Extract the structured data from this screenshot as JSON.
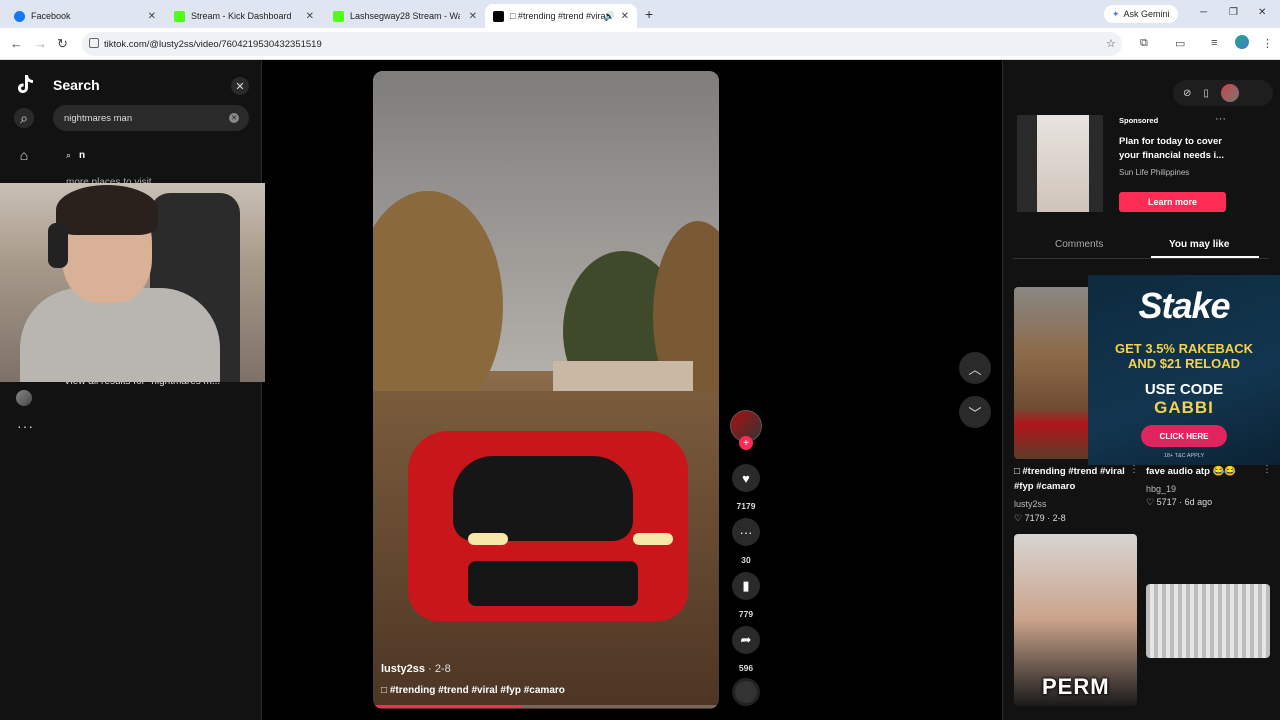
{
  "browser": {
    "tabs": [
      {
        "title": "Facebook",
        "favicon_color": "#1877f2"
      },
      {
        "title": "Stream - Kick Dashboard",
        "favicon_color": "#53fc18"
      },
      {
        "title": "Lashsegway28 Stream - Watch",
        "favicon_color": "#53fc18"
      },
      {
        "title": "□ #trending #trend #viral #",
        "favicon_color": "#000000"
      }
    ],
    "new_tab": "+",
    "gemini_label": "Ask Gemini",
    "url": "tiktok.com/@lusty2ss/video/7604219530432351519"
  },
  "search_panel": {
    "title": "Search",
    "query": "nightmares man",
    "suggestion": "n",
    "suggestion2": "more places to visit",
    "view_all": "View all results for \"nightmares m..."
  },
  "video": {
    "author": "lusty2ss",
    "date": "· 2-8",
    "caption": "□ #trending #trend #viral #fyp #camaro",
    "progress": 0.43
  },
  "actions": {
    "likes": "7179",
    "comments": "30",
    "saves": "779",
    "shares": "596"
  },
  "ad": {
    "label": "Sponsored",
    "title": "Plan for today to cover your financial needs i...",
    "brand": "Sun Life Philippines",
    "cta": "Learn more"
  },
  "right_tabs": {
    "comments": "Comments",
    "you_may_like": "You may like"
  },
  "recommendations": [
    {
      "title": "□ #trending #trend #viral #fyp #camaro",
      "author": "lusty2ss",
      "meta": "♡ 7179 · 2-8"
    },
    {
      "title": "fave audio atp 😂😂",
      "author": "hbg_19",
      "meta": "♡ 5717 · 6d ago"
    },
    {
      "overlay_text": "PERM"
    }
  ],
  "stake_ad": {
    "logo": "Stake",
    "line1": "GET 3.5% RAKEBACK",
    "line1b": "AND $21 RELOAD",
    "line2": "USE CODE",
    "line3": "GABBI",
    "button": "CLICK HERE",
    "fine": "18+ T&C APPLY"
  }
}
